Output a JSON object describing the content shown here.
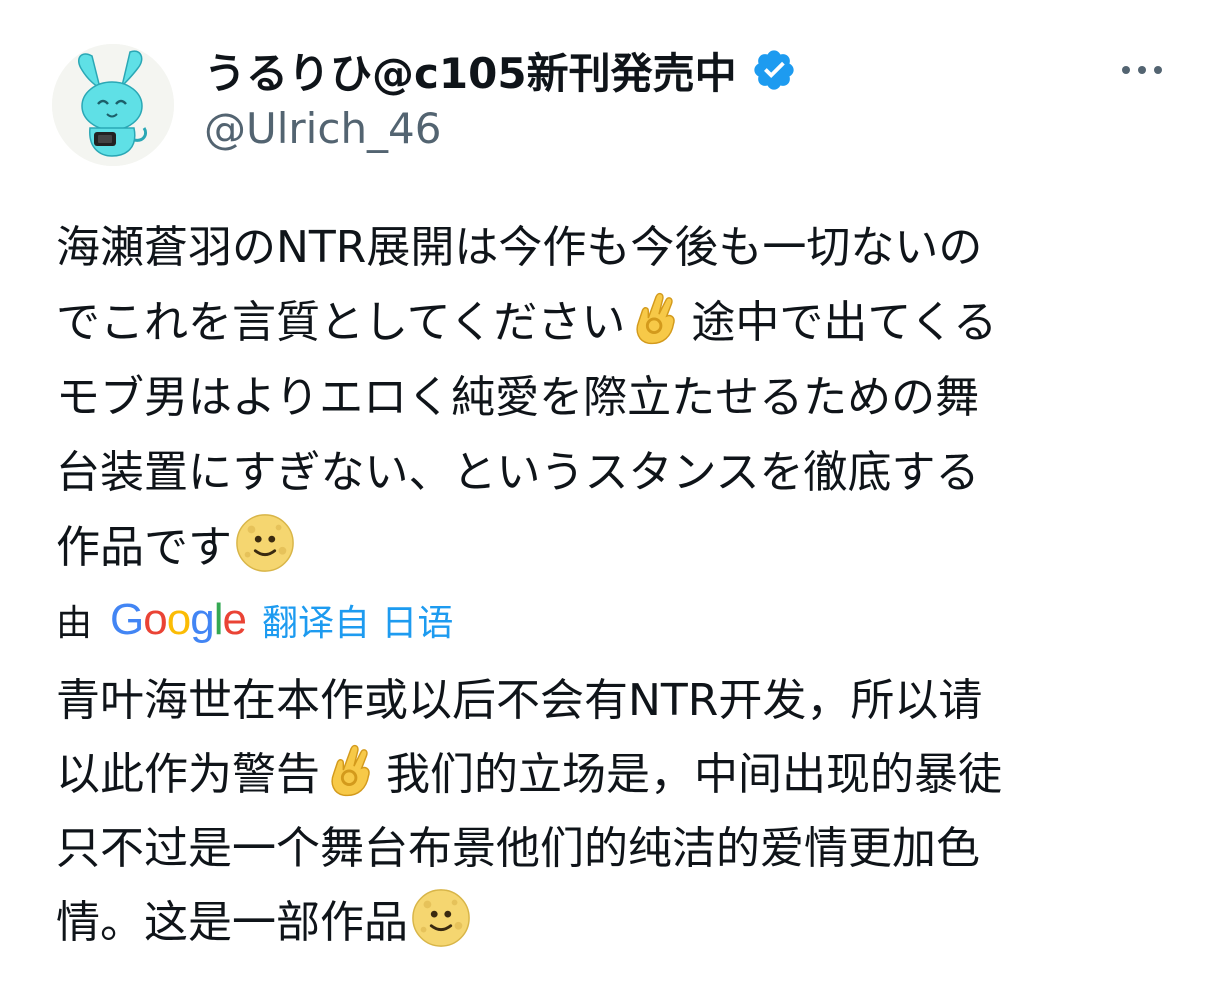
{
  "author": {
    "display_name": "うるりひ@c105新刊発売中",
    "handle": "@Ulrich_46",
    "verified": true,
    "avatar_icon": "cyan-rabbit-avatar"
  },
  "more_icon": "more-horizontal-icon",
  "tweet": {
    "lines": [
      "海瀬蒼羽のNTR展開は今作も今後も一切ないの",
      "でこれを言質としてください",
      "途中で出てくる",
      "モブ男はよりエロく純愛を際立たせるための舞",
      "台装置にすぎない、というスタンスを徹底する",
      "作品です"
    ]
  },
  "translation": {
    "by_label": "由",
    "logo_letters": [
      "G",
      "o",
      "o",
      "g",
      "l",
      "e"
    ],
    "link_label": "翻译自 日语",
    "lines": [
      "青叶海世在本作或以后不会有NTR开发，所以请",
      "以此作为警告",
      "我们的立场是，中间出现的暴徒",
      "只不过是一个舞台布景他们的纯洁的爱情更加色",
      "情。这是一部作品"
    ]
  },
  "colors": {
    "text": "#0f1419",
    "secondary": "#536471",
    "link": "#1d9bf0",
    "verified_badge": "#1d9bf0"
  }
}
